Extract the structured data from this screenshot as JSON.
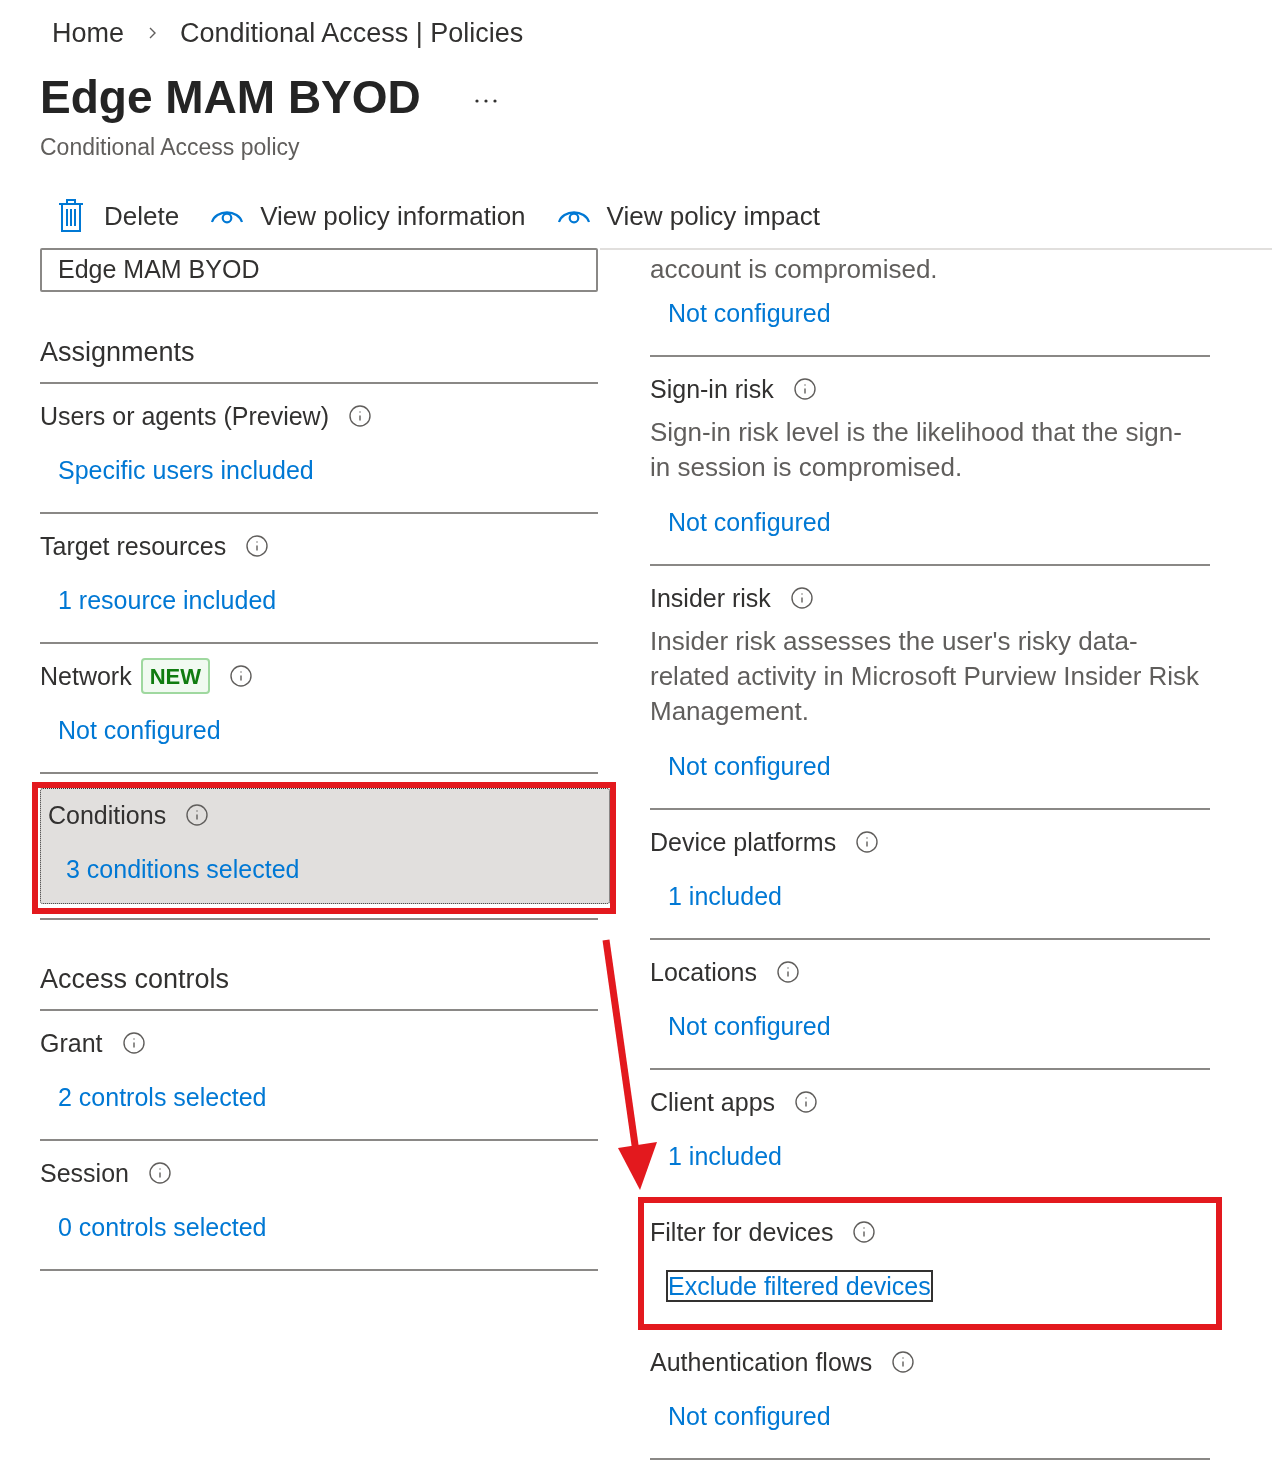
{
  "breadcrumb": [
    {
      "label": "Home"
    },
    {
      "label": "Conditional Access | Policies"
    }
  ],
  "header": {
    "title": "Edge MAM BYOD",
    "subtitle": "Conditional Access policy"
  },
  "toolbar": [
    {
      "kind": "delete",
      "label": "Delete"
    },
    {
      "kind": "view",
      "label": "View policy information"
    },
    {
      "kind": "view",
      "label": "View policy impact"
    }
  ],
  "name_field": {
    "value": "Edge MAM BYOD"
  },
  "left_panel": {
    "groups": [
      {
        "heading": "Assignments",
        "sections": [
          {
            "title": "Users or agents (Preview)",
            "link": "Specific users included",
            "selected": false,
            "annotated": false,
            "focused": false
          },
          {
            "title": "Target resources",
            "link": "1 resource included",
            "selected": false,
            "annotated": false,
            "focused": false
          },
          {
            "title": "Network",
            "badge": "NEW",
            "link": "Not configured",
            "selected": false,
            "annotated": false,
            "focused": false
          },
          {
            "title": "Conditions",
            "link": "3 conditions selected",
            "selected": true,
            "annotated": true,
            "focused": false
          }
        ]
      },
      {
        "heading": "Access controls",
        "sections": [
          {
            "title": "Grant",
            "link": "2 controls selected",
            "selected": false,
            "annotated": false,
            "focused": false
          },
          {
            "title": "Session",
            "link": "0 controls selected",
            "selected": false,
            "annotated": false,
            "focused": false
          }
        ]
      }
    ]
  },
  "right_panel": {
    "sections": [
      {
        "description": [
          "account is compromised."
        ],
        "link": "Not configured",
        "selected": false,
        "annotated": false,
        "focused": false
      },
      {
        "title": "Sign-in risk",
        "description": [
          "Sign-in risk level is the likelihood that the sign-",
          "in session is compromised."
        ],
        "link": "Not configured",
        "selected": false,
        "annotated": false,
        "focused": false
      },
      {
        "title": "Insider risk",
        "description": [
          "Insider risk assesses the user's risky data-",
          "related activity in Microsoft Purview Insider Risk",
          "Management."
        ],
        "link": "Not configured",
        "selected": false,
        "annotated": false,
        "focused": false
      },
      {
        "title": "Device platforms",
        "link": "1 included",
        "selected": false,
        "annotated": false,
        "focused": false
      },
      {
        "title": "Locations",
        "link": "Not configured",
        "selected": false,
        "annotated": false,
        "focused": false
      },
      {
        "title": "Client apps",
        "link": "1 included",
        "selected": false,
        "annotated": false,
        "focused": false
      },
      {
        "title": "Filter for devices",
        "link": "Exclude filtered devices",
        "selected": false,
        "annotated": true,
        "focused": true
      },
      {
        "title": "Authentication flows",
        "link": "Not configured",
        "selected": false,
        "annotated": false,
        "focused": false
      }
    ]
  }
}
